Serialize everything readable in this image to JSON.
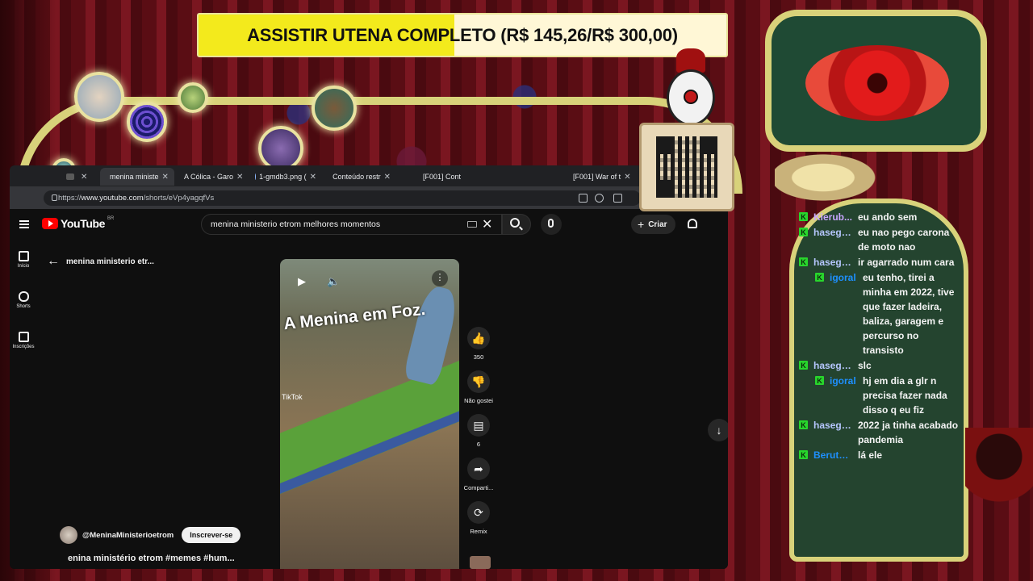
{
  "goal": {
    "text": "ASSISTIR UTENA COMPLETO (R$ 145,26/R$ 300,00)",
    "progress_fraction": 0.4842
  },
  "browser": {
    "tabs": [
      {
        "label": "",
        "active": false,
        "color": "#5a5a5a"
      },
      {
        "label": "menina ministe",
        "active": true,
        "color": "#ff0000"
      },
      {
        "label": "A Cólica - Garo",
        "active": false,
        "color": "#c0392b"
      },
      {
        "label": "1-gmdb3.png (",
        "active": false,
        "color": "#8ab4f8"
      },
      {
        "label": "Conteúdo restr",
        "active": false,
        "color": "#9aa0a6"
      },
      {
        "label": "[F001] Cont",
        "active": false,
        "color": "#9aa0a6"
      },
      {
        "label": "[F001] War of t",
        "active": false,
        "color": "#9aa0a6"
      }
    ],
    "url_prefix": "https://",
    "url_host": "www.youtube.com",
    "url_path": "/shorts/eVp4yagqfVs"
  },
  "youtube": {
    "logo_text": "YouTube",
    "region": "BR",
    "search_value": "menina ministerio etrom melhores momentos",
    "create_label": "Criar",
    "sidebar": [
      {
        "label": "Início",
        "icon": "home-icon"
      },
      {
        "label": "Shorts",
        "icon": "shorts-icon"
      },
      {
        "label": "Inscrições",
        "icon": "subscriptions-icon"
      }
    ],
    "back_title": "menina ministerio etr...",
    "video_overlay_text": "A Menina em Foz.",
    "tiktok_label": "TikTok",
    "actions": [
      {
        "label": "350",
        "icon": "like-icon",
        "glyph": "👍"
      },
      {
        "label": "Não gostei",
        "icon": "dislike-icon",
        "glyph": "👎"
      },
      {
        "label": "6",
        "icon": "comment-icon",
        "glyph": "▤"
      },
      {
        "label": "Comparti...",
        "icon": "share-icon",
        "glyph": "➦"
      },
      {
        "label": "Remix",
        "icon": "remix-icon",
        "glyph": "⟳"
      }
    ],
    "channel_name": "@MeninaMinisterioetrom",
    "subscribe_label": "Inscrever-se",
    "short_title": "enina ministério etrom #memes #hum..."
  },
  "chat": {
    "messages": [
      {
        "user": "Kierub...",
        "user_color": "#c9a6ff",
        "text": "eu ando sem",
        "indent": false
      },
      {
        "user": "hasega...",
        "user_color": "#b7c7ff",
        "text": "eu nao pego carona de moto nao",
        "indent": false
      },
      {
        "user": "hasega...",
        "user_color": "#b7c7ff",
        "text": "ir agarrado num cara",
        "indent": false
      },
      {
        "user": "igoral",
        "user_color": "#1e90ff",
        "text": "eu tenho, tirei a minha em 2022, tive que fazer ladeira, baliza, garagem e percurso no transisto",
        "indent": true
      },
      {
        "user": "hasega...",
        "user_color": "#b7c7ff",
        "text": "slc",
        "indent": false
      },
      {
        "user": "igoral",
        "user_color": "#1e90ff",
        "text": "hj em dia a glr n precisa fazer nada disso q eu fiz",
        "indent": true
      },
      {
        "user": "hasega...",
        "user_color": "#b7c7ff",
        "text": "2022 ja tinha acabado pandemia",
        "indent": false
      },
      {
        "user": "Beruto...",
        "user_color": "#1e90ff",
        "text": "lá ele",
        "indent": false
      }
    ],
    "badge_letter": "K"
  }
}
